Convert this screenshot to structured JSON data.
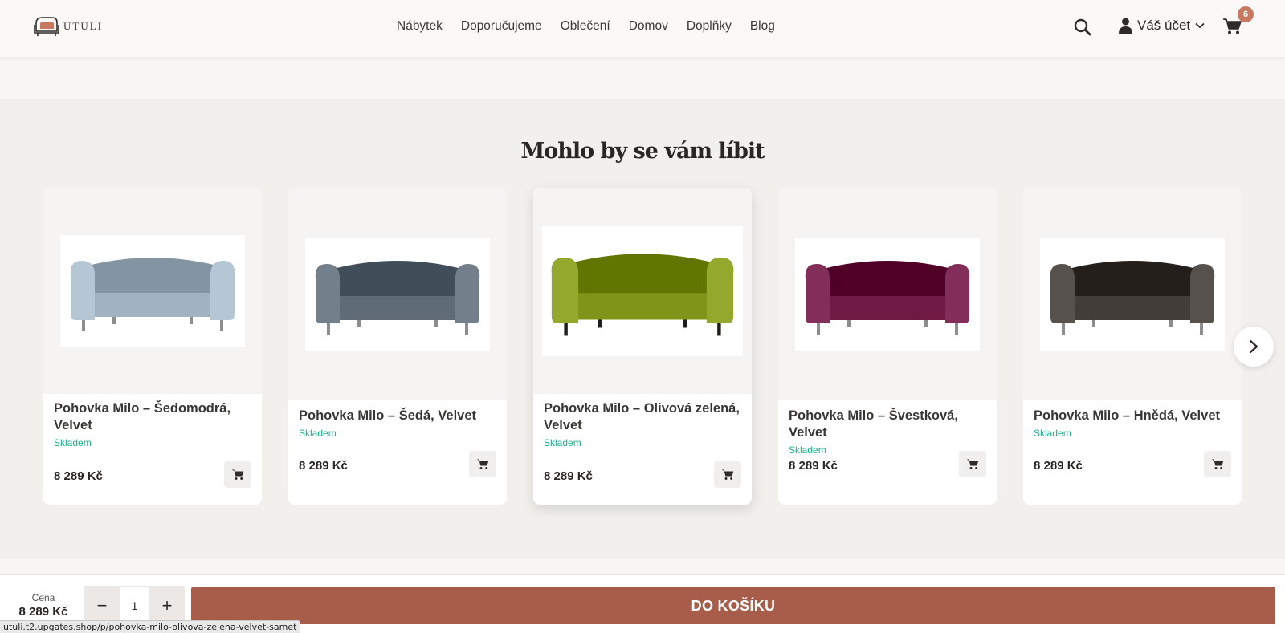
{
  "header": {
    "logo_text": "UTULI",
    "nav": [
      "Nábytek",
      "Doporučujeme",
      "Oblečení",
      "Domov",
      "Doplňky",
      "Blog"
    ],
    "account_label": "Váš účet",
    "cart_count": "6",
    "icons": {
      "search": "search-icon",
      "account": "user-icon",
      "cart": "cart-icon"
    }
  },
  "section": {
    "title": "Mohlo by se vám líbit"
  },
  "products": [
    {
      "name": "Pohovka Milo – Šedomodrá, Velvet",
      "stock": "Skladem",
      "price": "8 289 Kč",
      "color": "#a1b2c0"
    },
    {
      "name": "Pohovka Milo – Šedá, Velvet",
      "stock": "Skladem",
      "price": "8 289 Kč",
      "color": "#5f6b77"
    },
    {
      "name": "Pohovka Milo – Olivová zelená, Velvet",
      "stock": "Skladem",
      "price": "8 289 Kč",
      "color": "#7f9418"
    },
    {
      "name": "Pohovka Milo – Švestková, Velvet",
      "stock": "Skladem",
      "price": "8 289 Kč",
      "color": "#6e1a44"
    },
    {
      "name": "Pohovka Milo – Hnědá, Velvet",
      "stock": "Skladem",
      "price": "8 289 Kč",
      "color": "#433d3a"
    }
  ],
  "buy_bar": {
    "price_label": "Cena",
    "price": "8 289 Kč",
    "quantity": "1",
    "minus": "−",
    "plus": "+",
    "add_to_cart": "DO KOŠÍKU"
  },
  "status_url": "utuli.t2.upgates.shop/p/pohovka-milo-olivova-zelena-velvet-samet",
  "colors": {
    "accent": "#a85d4b",
    "stock": "#19b08a",
    "badge": "#c8785f"
  }
}
